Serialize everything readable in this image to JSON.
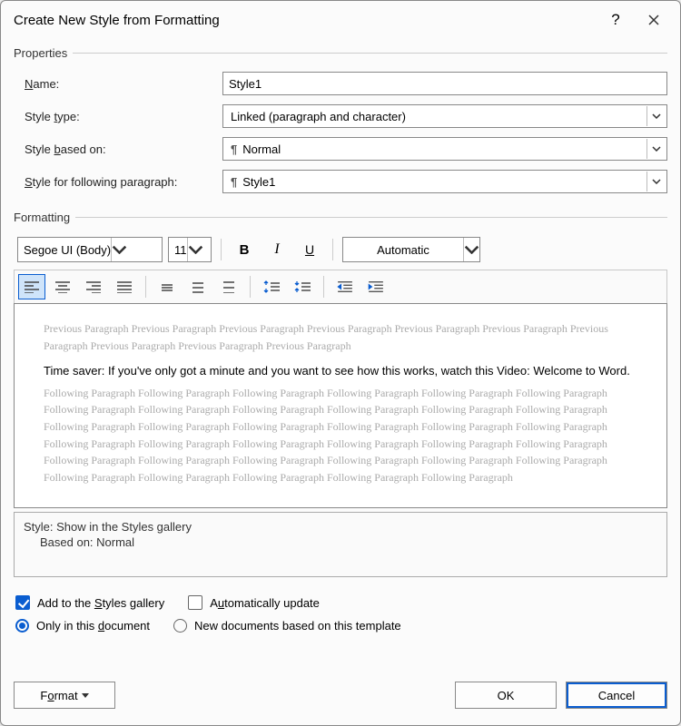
{
  "window": {
    "title": "Create New Style from Formatting"
  },
  "groups": {
    "properties": "Properties",
    "formatting": "Formatting"
  },
  "labels": {
    "name": {
      "pre": "",
      "u": "N",
      "post": "ame:"
    },
    "style_type": {
      "pre": "Style ",
      "u": "t",
      "post": "ype:"
    },
    "based_on": {
      "pre": "Style ",
      "u": "b",
      "post": "ased on:"
    },
    "following": {
      "pre": "",
      "u": "S",
      "post": "tyle for following paragraph:"
    }
  },
  "values": {
    "name": "Style1",
    "style_type": "Linked (paragraph and character)",
    "based_on": "Normal",
    "following": "Style1",
    "font": "Segoe UI (Body)",
    "size": "11",
    "color": "Automatic"
  },
  "preview": {
    "prev": "Previous Paragraph Previous Paragraph Previous Paragraph Previous Paragraph Previous Paragraph Previous Paragraph Previous Paragraph Previous Paragraph Previous Paragraph Previous Paragraph",
    "sample": "Time saver: If you've only got a minute and you want to see how this works, watch this Video: Welcome to Word.",
    "foll": "Following Paragraph Following Paragraph Following Paragraph Following Paragraph Following Paragraph Following Paragraph Following Paragraph Following Paragraph Following Paragraph Following Paragraph Following Paragraph Following Paragraph Following Paragraph Following Paragraph Following Paragraph Following Paragraph Following Paragraph Following Paragraph Following Paragraph Following Paragraph Following Paragraph Following Paragraph Following Paragraph Following Paragraph Following Paragraph Following Paragraph Following Paragraph Following Paragraph Following Paragraph Following Paragraph Following Paragraph Following Paragraph Following Paragraph Following Paragraph Following Paragraph"
  },
  "desc": {
    "line1": "Style: Show in the Styles gallery",
    "line2": "Based on: Normal"
  },
  "checks": {
    "add_gallery": {
      "pre": "Add to the ",
      "u": "S",
      "post": "tyles gallery",
      "checked": true
    },
    "auto_update": {
      "pre": "A",
      "u": "u",
      "post": "tomatically update",
      "checked": false
    }
  },
  "radios": {
    "only_doc": {
      "pre": "Only in this ",
      "u": "d",
      "post": "ocument",
      "checked": true
    },
    "new_docs": {
      "text": "New documents based on this template",
      "checked": false
    }
  },
  "buttons": {
    "format": {
      "pre": "F",
      "u": "o",
      "post": "rmat"
    },
    "ok": "OK",
    "cancel": "Cancel"
  }
}
